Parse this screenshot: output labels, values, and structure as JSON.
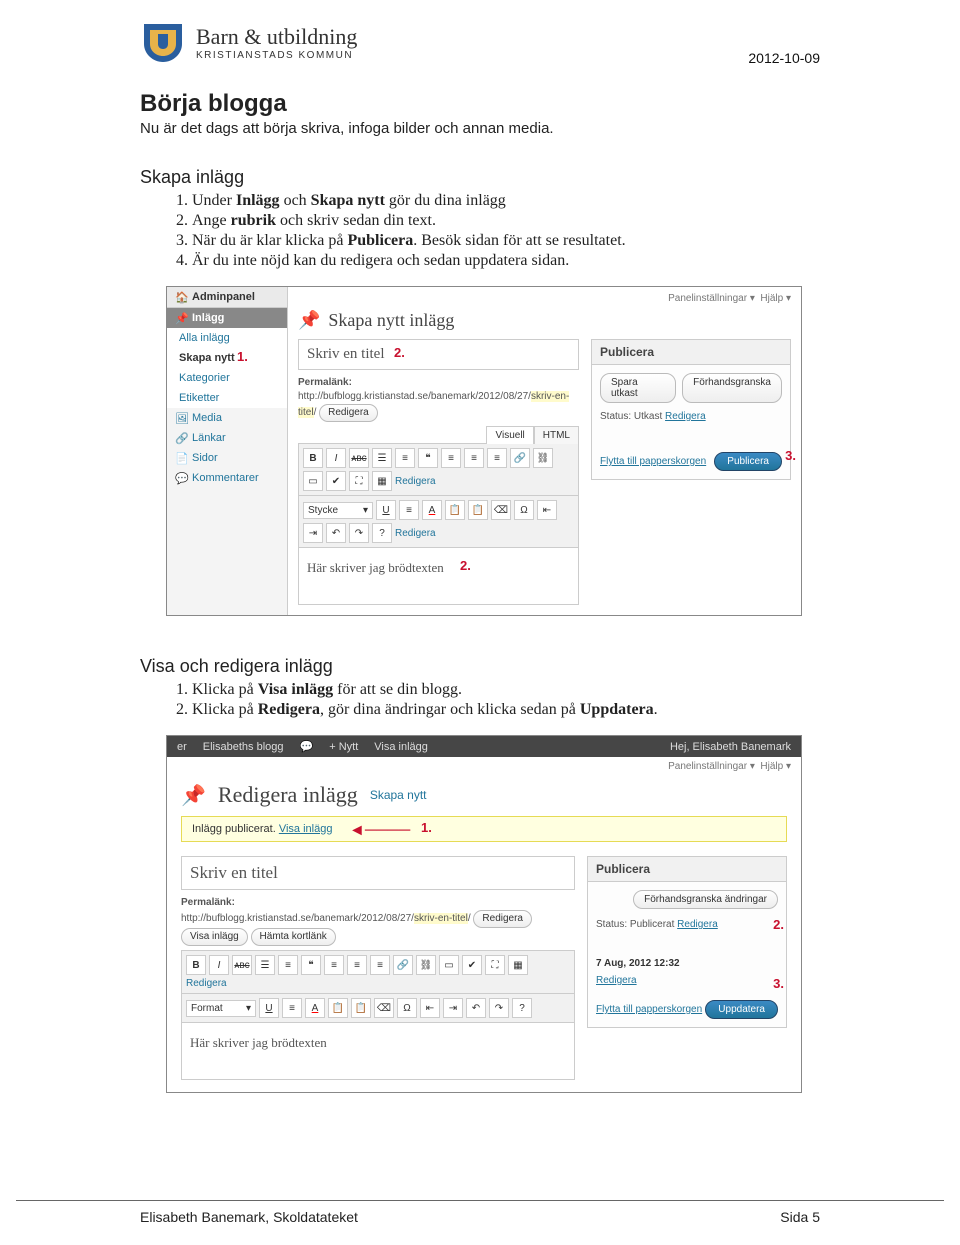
{
  "header": {
    "org_title": "Barn & utbildning",
    "org_sub": "KRISTIANSTADS KOMMUN",
    "date": "2012-10-09"
  },
  "h1": "Börja blogga",
  "intro": "Nu är det dags att börja skriva, infoga bilder och annan media.",
  "sec1": {
    "title": "Skapa inlägg",
    "items": [
      {
        "pre": "Under ",
        "b1": "Inlägg",
        "mid": " och ",
        "b2": "Skapa nytt",
        "post": " gör du dina inlägg"
      },
      {
        "pre": "Ange ",
        "b1": "rubrik",
        "post": " och skriv sedan din text."
      },
      {
        "pre": "När du är klar klicka på ",
        "b1": "Publicera",
        "post": ". Besök sidan för att se resultatet."
      },
      {
        "pre": "Är du inte nöjd kan du redigera och sedan uppdatera sidan."
      }
    ]
  },
  "ss1": {
    "topbar": {
      "panel": "Panelinställningar ▾",
      "help": "Hjälp ▾"
    },
    "sidebar": {
      "admin": "Adminpanel",
      "posts": "Inlägg",
      "subs": [
        "Alla inlägg",
        "Skapa nytt",
        "Kategorier",
        "Etiketter"
      ],
      "media": "Media",
      "links": "Länkar",
      "pages": "Sidor",
      "comments": "Kommentarer"
    },
    "title": "Skapa nytt inlägg",
    "title_input": "Skriv en titel",
    "permalink_label": "Permalänk:",
    "permalink_url_prefix": "http://bufblogg.kristianstad.se/banemark/2012/08/27/",
    "permalink_slug": "skriv-en-titel",
    "btn_edit": "Redigera",
    "tab_visual": "Visuell",
    "tab_html": "HTML",
    "style_dd": "Stycke",
    "body_text": "Här skriver jag brödtexten",
    "publish": {
      "header": "Publicera",
      "save_draft": "Spara utkast",
      "preview": "Förhandsgranska",
      "status_label": "Status:",
      "status_val": "Utkast",
      "edit": "Redigera",
      "trash": "Flytta till papperskorgen",
      "publish_btn": "Publicera"
    },
    "toolbar_link": "Redigera",
    "callouts": {
      "c1": "1.",
      "c2a": "2.",
      "c2b": "2.",
      "c3": "3."
    }
  },
  "sec2": {
    "title": "Visa och redigera inlägg",
    "items": [
      {
        "pre": "Klicka på ",
        "b1": "Visa inlägg",
        "post": " för att se din blogg."
      },
      {
        "pre": "Klicka på ",
        "b1": "Redigera",
        "mid": ", gör dina ändringar och klicka sedan på ",
        "b2": "Uppdatera",
        "post": "."
      }
    ]
  },
  "ss2": {
    "adminbar": {
      "left": [
        "er",
        "Elisabeths blogg",
        "",
        "+ Nytt",
        "Visa inlägg"
      ],
      "right": "Hej, Elisabeth Banemark"
    },
    "topbar": {
      "panel": "Panelinställningar ▾",
      "help": "Hjälp ▾"
    },
    "title": "Redigera inlägg",
    "title_link": "Skapa nytt",
    "msg_pre": "Inlägg publicerat. ",
    "msg_link": "Visa inlägg",
    "title_input": "Skriv en titel",
    "permalink_label": "Permalänk:",
    "permalink_url_prefix": "http://bufblogg.kristianstad.se/banemark/2012/08/27/",
    "permalink_slug": "skriv-en-titel",
    "btn_edit": "Redigera",
    "btn_view": "Visa inlägg",
    "btn_short": "Hämta kortlänk",
    "format_dd": "Format",
    "body_text": "Här skriver jag brödtexten",
    "publish": {
      "header": "Publicera",
      "preview": "Förhandsgranska ändringar",
      "status_label": "Status:",
      "status_val": "Publicerat",
      "edit": "Redigera",
      "date": "7 Aug, 2012 12:32",
      "edit2": "Redigera",
      "trash": "Flytta till papperskorgen",
      "update_btn": "Uppdatera"
    },
    "toolbar_link": "Redigera",
    "callouts": {
      "c1": "1.",
      "c2": "2.",
      "c3": "3."
    }
  },
  "footer": {
    "left": "Elisabeth Banemark, Skoldatateket",
    "right": "Sida 5"
  }
}
